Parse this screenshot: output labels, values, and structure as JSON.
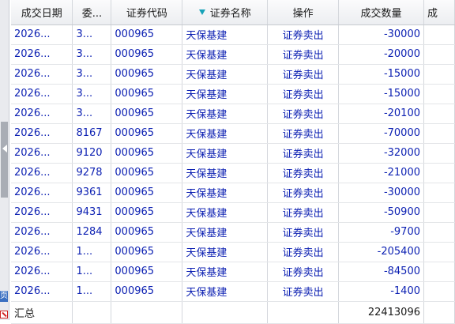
{
  "columns": [
    "成交日期",
    "委...",
    "证券代码",
    "证券名称",
    "操作",
    "成交数量",
    "成"
  ],
  "rows": [
    {
      "date": "2026...",
      "entrust": "3...",
      "code": "000965",
      "name": "天保基建",
      "op": "证券卖出",
      "qty": "-30000"
    },
    {
      "date": "2026...",
      "entrust": "3...",
      "code": "000965",
      "name": "天保基建",
      "op": "证券卖出",
      "qty": "-20000"
    },
    {
      "date": "2026...",
      "entrust": "3...",
      "code": "000965",
      "name": "天保基建",
      "op": "证券卖出",
      "qty": "-15000"
    },
    {
      "date": "2026...",
      "entrust": "3...",
      "code": "000965",
      "name": "天保基建",
      "op": "证券卖出",
      "qty": "-15000"
    },
    {
      "date": "2026...",
      "entrust": "3...",
      "code": "000965",
      "name": "天保基建",
      "op": "证券卖出",
      "qty": "-20100"
    },
    {
      "date": "2026...",
      "entrust": "8167",
      "code": "000965",
      "name": "天保基建",
      "op": "证券卖出",
      "qty": "-70000"
    },
    {
      "date": "2026...",
      "entrust": "9120",
      "code": "000965",
      "name": "天保基建",
      "op": "证券卖出",
      "qty": "-32000"
    },
    {
      "date": "2026...",
      "entrust": "9278",
      "code": "000965",
      "name": "天保基建",
      "op": "证券卖出",
      "qty": "-21000"
    },
    {
      "date": "2026...",
      "entrust": "9361",
      "code": "000965",
      "name": "天保基建",
      "op": "证券卖出",
      "qty": "-30000"
    },
    {
      "date": "2026...",
      "entrust": "9431",
      "code": "000965",
      "name": "天保基建",
      "op": "证券卖出",
      "qty": "-50900"
    },
    {
      "date": "2026...",
      "entrust": "1284",
      "code": "000965",
      "name": "天保基建",
      "op": "证券卖出",
      "qty": "-9700"
    },
    {
      "date": "2026...",
      "entrust": "1...",
      "code": "000965",
      "name": "天保基建",
      "op": "证券卖出",
      "qty": "-205400"
    },
    {
      "date": "2026...",
      "entrust": "1...",
      "code": "000965",
      "name": "天保基建",
      "op": "证券卖出",
      "qty": "-84500"
    },
    {
      "date": "2026...",
      "entrust": "1...",
      "code": "000965",
      "name": "天保基建",
      "op": "证券卖出",
      "qty": "-1400"
    }
  ],
  "footer": {
    "label": "汇总",
    "total_qty": "22413096"
  },
  "side_tab": "页",
  "colors": {
    "text_blue": "#0b1fb2",
    "sort_marker": "#17a2b8"
  }
}
